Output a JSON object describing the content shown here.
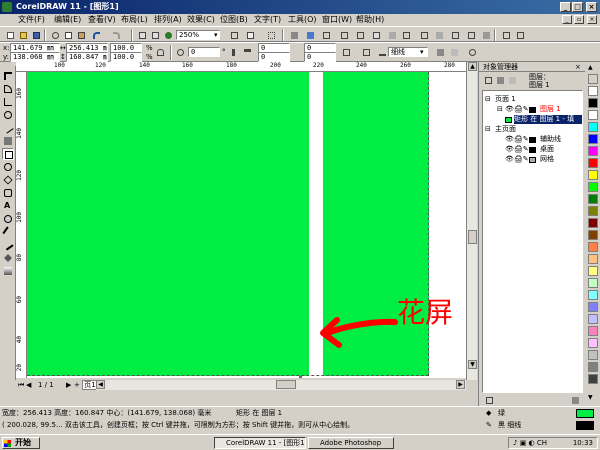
{
  "window": {
    "title": "CorelDRAW 11 - [图形1]"
  },
  "menu": [
    "文件(F)",
    "编辑(E)",
    "查看(V)",
    "布局(L)",
    "排列(A)",
    "效果(C)",
    "位图(B)",
    "文字(T)",
    "工具(O)",
    "窗口(W)",
    "帮助(H)"
  ],
  "standard_toolbar": {
    "zoom": "250%"
  },
  "property_bar": {
    "x": "141.679 ㎜",
    "y": "138.068 ㎜",
    "width": "256.413 ㎜",
    "height": "160.847 ㎜",
    "scale_x": "100.0",
    "scale_y": "100.0",
    "scale_unit": "%",
    "rotation": "0",
    "rotation_unit": "°",
    "corner_values": [
      "0",
      "0",
      "0",
      "0"
    ],
    "outline_label": "细线"
  },
  "ruler": {
    "h_labels": [
      "100",
      "120",
      "140",
      "160",
      "180",
      "200",
      "220",
      "240",
      "260",
      "280"
    ],
    "v_labels": [
      "160",
      "140",
      "120",
      "100",
      "80",
      "60",
      "40",
      "20"
    ]
  },
  "annotation": {
    "text": "花屏",
    "color": "#ff0000"
  },
  "page_tabs": {
    "counter": "1 / 1",
    "page_label": "页1"
  },
  "docker": {
    "title": "对象管理器",
    "top_label_1": "图层：",
    "top_label_2": "图层 1",
    "tree": {
      "page1": "页面 1",
      "layer1": "图层 1",
      "object": "矩形 在 图层 1 - 填",
      "master": "主页面",
      "guides": "辅助线",
      "desktop": "桌面",
      "grid": "网格"
    }
  },
  "palette_colors": [
    "#ffffff",
    "#000000",
    "#ffffff",
    "#00ffff",
    "#0000ff",
    "#ff00ff",
    "#ff0000",
    "#ffff00",
    "#00ff00",
    "#008000",
    "#808000",
    "#800000",
    "#804000",
    "#ff8040",
    "#ffc080",
    "#ffff80",
    "#c0ffc0",
    "#80ffff",
    "#8080ff",
    "#c0c0ff",
    "#ff80c0",
    "#ffc0ff",
    "#c0c0c0",
    "#808080",
    "#404040"
  ],
  "status": {
    "line1_size": "宽度：256.413  高度：160.847  中心：(141.679, 138.068)  毫米",
    "line1_obj": "矩形 在 图层 1",
    "line2": "( 200.028, 99.5... 双击该工具，创建页框；按 Ctrl 键并拖，可限制为方形；按 Shift 键并拖，则可从中心绘制。",
    "fill_label": "绿",
    "outline_label": "黑  细线",
    "fill_color": "#00ee44"
  },
  "taskbar": {
    "start": "开始",
    "tasks": [
      "CorelDRAW 11 - [图形1]",
      "Adobe Photoshop"
    ],
    "clock": "10:33"
  }
}
